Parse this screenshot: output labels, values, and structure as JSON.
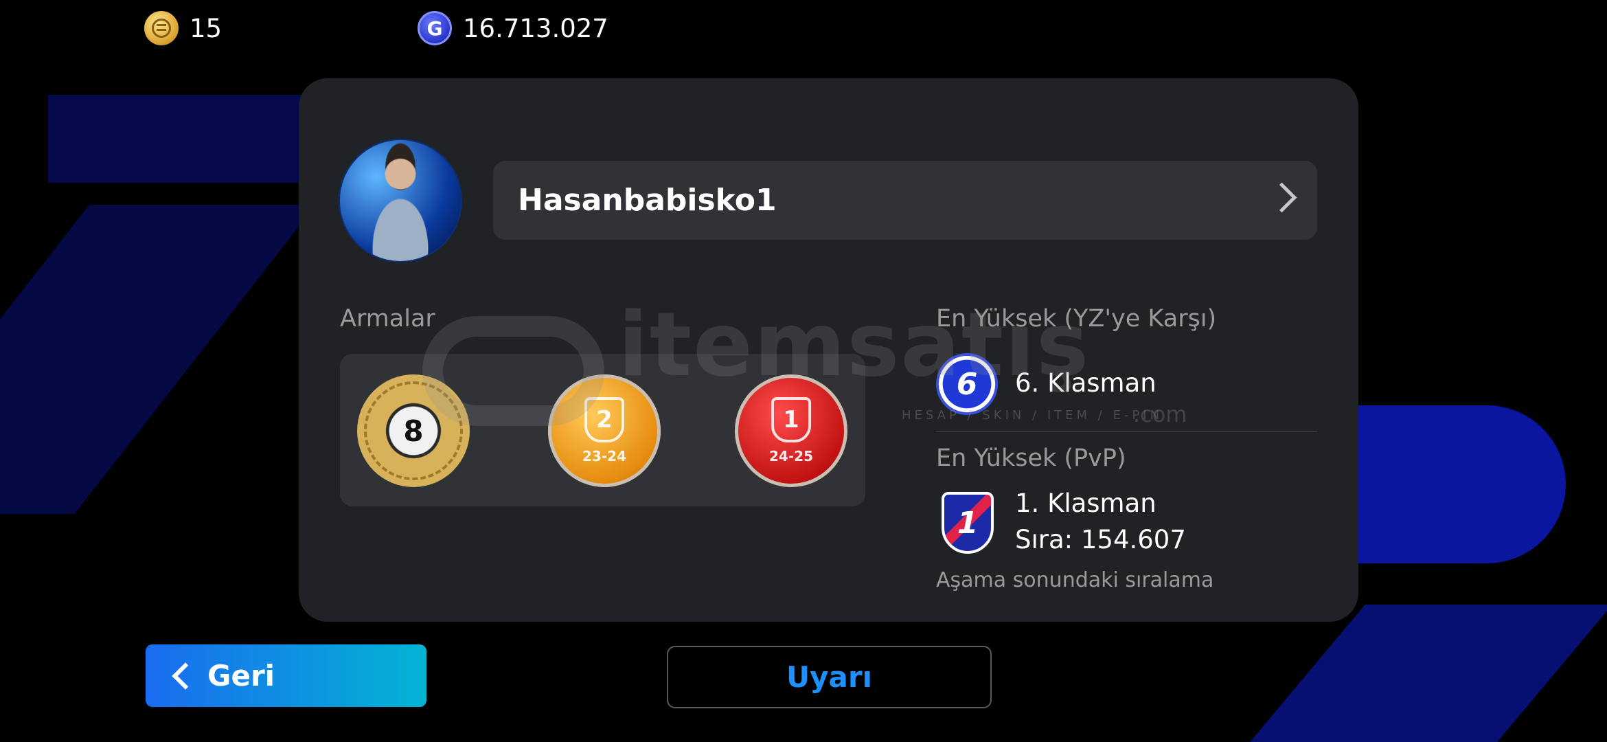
{
  "currency": {
    "coins": "15",
    "gp": "16.713.027",
    "gp_icon_letter": "G"
  },
  "profile": {
    "player_name": "Hasanbabisko1"
  },
  "badges": {
    "label": "Armalar",
    "anniversary_number": "8",
    "items": [
      {
        "rank": "2",
        "season": "23-24",
        "color": "#e58a0c"
      },
      {
        "rank": "1",
        "season": "24-25",
        "color": "#c01212"
      }
    ]
  },
  "rankings": {
    "ai": {
      "label": "En Yüksek (YZ'ye Karşı)",
      "icon_number": "6",
      "division": "6. Klasman"
    },
    "pvp": {
      "label": "En Yüksek (PvP)",
      "icon_number": "1",
      "division": "1. Klasman",
      "position": "Sıra: 154.607",
      "note": "Aşama sonundaki sıralama"
    }
  },
  "watermark": {
    "text": "itemsatış",
    "subtext": "HESAP / SKIN / ITEM / E-PIN",
    "suffix": ".com"
  },
  "buttons": {
    "back": "Geri",
    "warn": "Uyarı"
  },
  "colors": {
    "accent_blue": "#1e90ff",
    "panel": "#202226"
  }
}
